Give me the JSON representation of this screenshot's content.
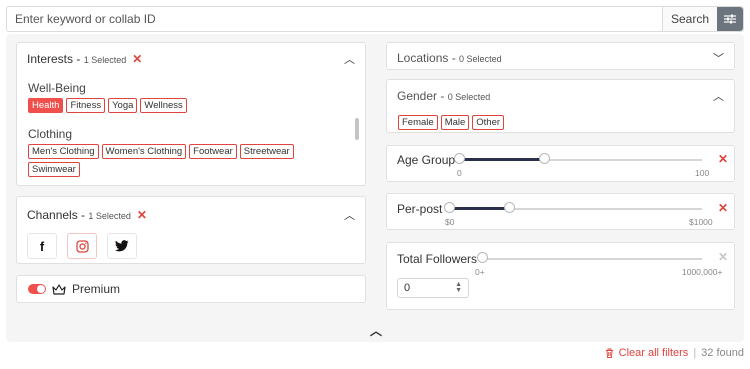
{
  "search": {
    "placeholder": "Enter keyword or collab ID",
    "button_label": "Search"
  },
  "interests": {
    "title": "Interests - ",
    "selected": "1 Selected",
    "groups": [
      {
        "label": "Well-Being",
        "tags": [
          "Health",
          "Fitness",
          "Yoga",
          "Wellness"
        ],
        "active": "Health"
      },
      {
        "label": "Clothing",
        "tags": [
          "Men's Clothing",
          "Women's Clothing",
          "Footwear",
          "Streetwear",
          "Swimwear"
        ]
      }
    ]
  },
  "channels": {
    "title": "Channels - ",
    "selected": "1 Selected",
    "icons": [
      "facebook-icon",
      "instagram-icon",
      "twitter-icon"
    ]
  },
  "premium": {
    "label": "Premium",
    "enabled": true
  },
  "locations": {
    "title": "Locations - ",
    "selected": "0 Selected"
  },
  "gender": {
    "title": "Gender - ",
    "selected": "0 Selected",
    "options": [
      "Female",
      "Male",
      "Other"
    ]
  },
  "age_group": {
    "label": "Age Group",
    "min_label": "0",
    "max_label": "100",
    "low": 0,
    "high": 0.35
  },
  "per_post": {
    "label": "Per-post",
    "min_label": "$0",
    "max_label": "$1000",
    "low": 0,
    "high": 0.24
  },
  "total_followers": {
    "label": "Total Followers",
    "min_label": "0+",
    "max_label": "1000,000+",
    "input_value": "0"
  },
  "footer": {
    "clear_label": "Clear all filters",
    "separator": "|",
    "found": "32 found"
  },
  "colors": {
    "accent_red": "#e0443e",
    "slider_fill": "#2a2f4a",
    "filter_button": "#6c757d"
  }
}
